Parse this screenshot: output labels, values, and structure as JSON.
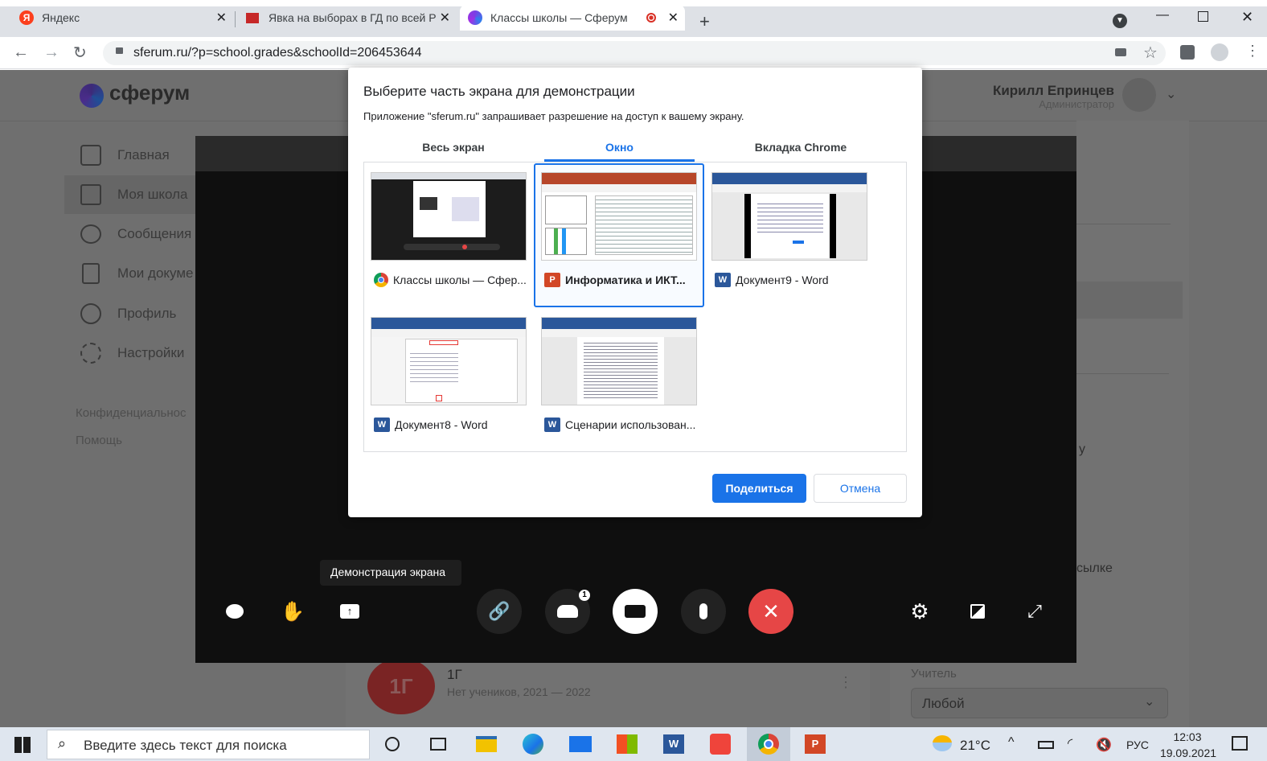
{
  "browser": {
    "tabs": [
      {
        "label": "Яндекс"
      },
      {
        "label": "Явка на выборах в ГД по всей Р"
      },
      {
        "label": "Классы школы — Сферум"
      }
    ],
    "url": "sferum.ru/?p=school.grades&schoolId=206453644"
  },
  "app": {
    "logo_text": "сферум",
    "user_name": "Кирилл Епринцев",
    "user_role": "Администратор",
    "sidebar": [
      {
        "label": "Главная",
        "icon": "grid-icon"
      },
      {
        "label": "Моя школа",
        "icon": "school-icon"
      },
      {
        "label": "Сообщения",
        "icon": "chat-icon"
      },
      {
        "label": "Мои докуме",
        "icon": "document-icon"
      },
      {
        "label": "Профиль",
        "icon": "profile-icon"
      },
      {
        "label": "Настройки",
        "icon": "gear-icon"
      }
    ],
    "footer_links": [
      "Конфиденциальнос",
      "Помощь"
    ],
    "class_avatar": "1Г",
    "class_name": "1Г",
    "class_info": "Нет учеников, 2021 — 2022",
    "right_frag1": "у",
    "right_frag2": "сылке",
    "filter_label": "Учитель",
    "filter_value": "Любой"
  },
  "call": {
    "tooltip": "Демонстрация экрана",
    "participants_badge": "1"
  },
  "dialog": {
    "title": "Выберите часть экрана для демонстрации",
    "subtitle": "Приложение \"sferum.ru\" запрашивает разрешение на доступ к вашему экрану.",
    "tabs": [
      "Весь экран",
      "Окно",
      "Вкладка Chrome"
    ],
    "windows": [
      {
        "label": "Классы школы — Сфер...",
        "app": "chrome"
      },
      {
        "label": "Информатика и ИКТ...",
        "app": "powerpoint"
      },
      {
        "label": "Документ9 - Word",
        "app": "word"
      },
      {
        "label": "Документ8 - Word",
        "app": "word"
      },
      {
        "label": "Сценарии использован...",
        "app": "word"
      }
    ],
    "share_label": "Поделиться",
    "cancel_label": "Отмена"
  },
  "taskbar": {
    "search_placeholder": "Введите здесь текст для поиска",
    "temperature": "21°C",
    "lang": "РУС",
    "time": "12:03",
    "date": "19.09.2021"
  },
  "colors": {
    "accent": "#1a73e8",
    "end_call": "#e64646",
    "powerpoint": "#d24726",
    "word": "#2b579a"
  }
}
